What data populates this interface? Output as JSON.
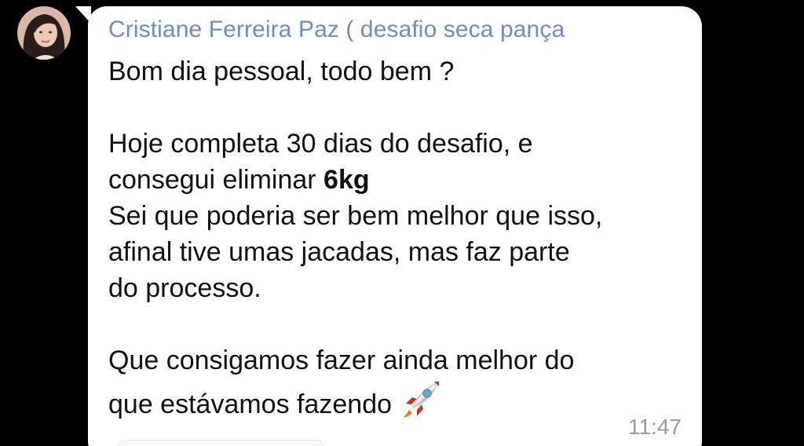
{
  "chat": {
    "sender_name": "Cristiane Ferreira Paz ( desafio seca pança",
    "avatar_icon": "profile-photo",
    "message": {
      "line1": "Bom dia pessoal, todo bem ?",
      "line2": "Hoje completa 30 dias do desafio, e",
      "line3_pre": "consegui eliminar ",
      "line3_bold": "6kg",
      "line4": "Sei que poderia ser bem melhor que isso,",
      "line5": "afinal tive umas jacadas, mas faz parte",
      "line6": "do processo.",
      "line7": "Que consigamos fazer ainda melhor do",
      "line8": "que estávamos fazendo",
      "emoji_icon": "rocket-emoji"
    },
    "time": "11:47"
  },
  "colors": {
    "background": "#000000",
    "bubble": "#ffffff",
    "sender_name": "#6a8ec5",
    "message_text": "#111111",
    "timestamp": "#9a9a9a"
  }
}
